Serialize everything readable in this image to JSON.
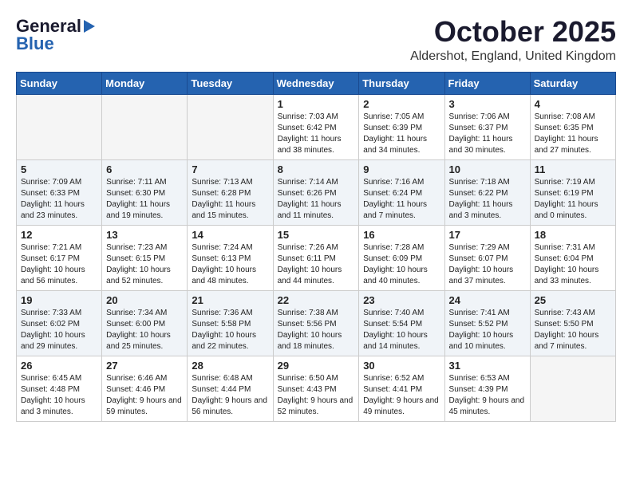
{
  "header": {
    "logo_general": "General",
    "logo_blue": "Blue",
    "month": "October 2025",
    "location": "Aldershot, England, United Kingdom"
  },
  "weekdays": [
    "Sunday",
    "Monday",
    "Tuesday",
    "Wednesday",
    "Thursday",
    "Friday",
    "Saturday"
  ],
  "weeks": [
    [
      {
        "day": "",
        "content": ""
      },
      {
        "day": "",
        "content": ""
      },
      {
        "day": "",
        "content": ""
      },
      {
        "day": "1",
        "content": "Sunrise: 7:03 AM\nSunset: 6:42 PM\nDaylight: 11 hours\nand 38 minutes."
      },
      {
        "day": "2",
        "content": "Sunrise: 7:05 AM\nSunset: 6:39 PM\nDaylight: 11 hours\nand 34 minutes."
      },
      {
        "day": "3",
        "content": "Sunrise: 7:06 AM\nSunset: 6:37 PM\nDaylight: 11 hours\nand 30 minutes."
      },
      {
        "day": "4",
        "content": "Sunrise: 7:08 AM\nSunset: 6:35 PM\nDaylight: 11 hours\nand 27 minutes."
      }
    ],
    [
      {
        "day": "5",
        "content": "Sunrise: 7:09 AM\nSunset: 6:33 PM\nDaylight: 11 hours\nand 23 minutes."
      },
      {
        "day": "6",
        "content": "Sunrise: 7:11 AM\nSunset: 6:30 PM\nDaylight: 11 hours\nand 19 minutes."
      },
      {
        "day": "7",
        "content": "Sunrise: 7:13 AM\nSunset: 6:28 PM\nDaylight: 11 hours\nand 15 minutes."
      },
      {
        "day": "8",
        "content": "Sunrise: 7:14 AM\nSunset: 6:26 PM\nDaylight: 11 hours\nand 11 minutes."
      },
      {
        "day": "9",
        "content": "Sunrise: 7:16 AM\nSunset: 6:24 PM\nDaylight: 11 hours\nand 7 minutes."
      },
      {
        "day": "10",
        "content": "Sunrise: 7:18 AM\nSunset: 6:22 PM\nDaylight: 11 hours\nand 3 minutes."
      },
      {
        "day": "11",
        "content": "Sunrise: 7:19 AM\nSunset: 6:19 PM\nDaylight: 11 hours\nand 0 minutes."
      }
    ],
    [
      {
        "day": "12",
        "content": "Sunrise: 7:21 AM\nSunset: 6:17 PM\nDaylight: 10 hours\nand 56 minutes."
      },
      {
        "day": "13",
        "content": "Sunrise: 7:23 AM\nSunset: 6:15 PM\nDaylight: 10 hours\nand 52 minutes."
      },
      {
        "day": "14",
        "content": "Sunrise: 7:24 AM\nSunset: 6:13 PM\nDaylight: 10 hours\nand 48 minutes."
      },
      {
        "day": "15",
        "content": "Sunrise: 7:26 AM\nSunset: 6:11 PM\nDaylight: 10 hours\nand 44 minutes."
      },
      {
        "day": "16",
        "content": "Sunrise: 7:28 AM\nSunset: 6:09 PM\nDaylight: 10 hours\nand 40 minutes."
      },
      {
        "day": "17",
        "content": "Sunrise: 7:29 AM\nSunset: 6:07 PM\nDaylight: 10 hours\nand 37 minutes."
      },
      {
        "day": "18",
        "content": "Sunrise: 7:31 AM\nSunset: 6:04 PM\nDaylight: 10 hours\nand 33 minutes."
      }
    ],
    [
      {
        "day": "19",
        "content": "Sunrise: 7:33 AM\nSunset: 6:02 PM\nDaylight: 10 hours\nand 29 minutes."
      },
      {
        "day": "20",
        "content": "Sunrise: 7:34 AM\nSunset: 6:00 PM\nDaylight: 10 hours\nand 25 minutes."
      },
      {
        "day": "21",
        "content": "Sunrise: 7:36 AM\nSunset: 5:58 PM\nDaylight: 10 hours\nand 22 minutes."
      },
      {
        "day": "22",
        "content": "Sunrise: 7:38 AM\nSunset: 5:56 PM\nDaylight: 10 hours\nand 18 minutes."
      },
      {
        "day": "23",
        "content": "Sunrise: 7:40 AM\nSunset: 5:54 PM\nDaylight: 10 hours\nand 14 minutes."
      },
      {
        "day": "24",
        "content": "Sunrise: 7:41 AM\nSunset: 5:52 PM\nDaylight: 10 hours\nand 10 minutes."
      },
      {
        "day": "25",
        "content": "Sunrise: 7:43 AM\nSunset: 5:50 PM\nDaylight: 10 hours\nand 7 minutes."
      }
    ],
    [
      {
        "day": "26",
        "content": "Sunrise: 6:45 AM\nSunset: 4:48 PM\nDaylight: 10 hours\nand 3 minutes."
      },
      {
        "day": "27",
        "content": "Sunrise: 6:46 AM\nSunset: 4:46 PM\nDaylight: 9 hours\nand 59 minutes."
      },
      {
        "day": "28",
        "content": "Sunrise: 6:48 AM\nSunset: 4:44 PM\nDaylight: 9 hours\nand 56 minutes."
      },
      {
        "day": "29",
        "content": "Sunrise: 6:50 AM\nSunset: 4:43 PM\nDaylight: 9 hours\nand 52 minutes."
      },
      {
        "day": "30",
        "content": "Sunrise: 6:52 AM\nSunset: 4:41 PM\nDaylight: 9 hours\nand 49 minutes."
      },
      {
        "day": "31",
        "content": "Sunrise: 6:53 AM\nSunset: 4:39 PM\nDaylight: 9 hours\nand 45 minutes."
      },
      {
        "day": "",
        "content": ""
      }
    ]
  ]
}
